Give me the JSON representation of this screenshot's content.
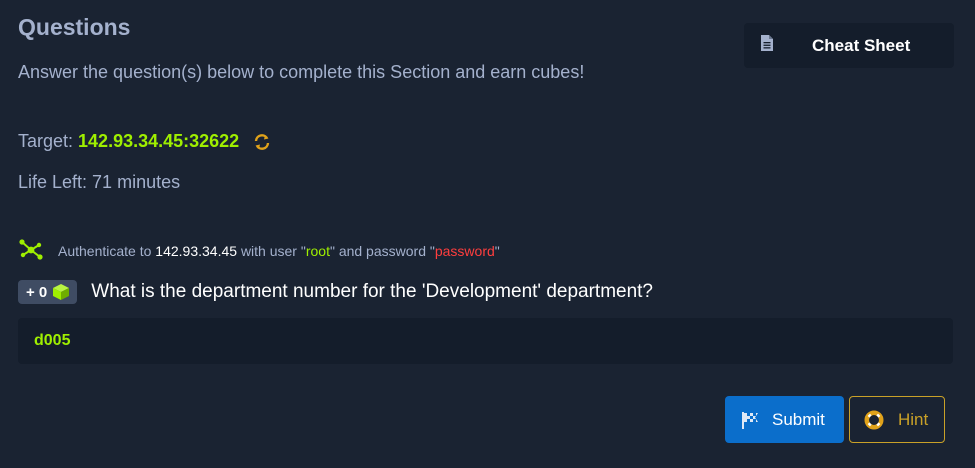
{
  "section": {
    "title": "Questions",
    "subtitle": "Answer the question(s) below to complete this Section and earn cubes!"
  },
  "cheat_sheet": {
    "label": "Cheat Sheet",
    "icon": "document-icon"
  },
  "target": {
    "label": "Target:",
    "address": "142.93.34.45:32622",
    "icon": "refresh-icon"
  },
  "life": {
    "text": "Life Left: 71 minutes"
  },
  "auth": {
    "icon": "network-icon",
    "prefix": "Authenticate to",
    "host": "142.93.34.45",
    "middle1": "with user \"",
    "user": "root",
    "middle2": "\" and password \"",
    "password": "password",
    "suffix": "\""
  },
  "question": {
    "badge": "+ 0",
    "badge_icon": "cube-icon",
    "text": "What is the department number for the 'Development' department?"
  },
  "answer": {
    "value": "d005"
  },
  "buttons": {
    "submit_label": "Submit",
    "submit_icon": "flag-icon",
    "hint_label": "Hint",
    "hint_icon": "lifebuoy-icon"
  },
  "colors": {
    "background": "#1a2332",
    "panel": "#141d2b",
    "accent_green": "#9fef00",
    "accent_red": "#ff3e3e",
    "submit_blue": "#0b6ecb",
    "hint_gold": "#c9a128"
  }
}
